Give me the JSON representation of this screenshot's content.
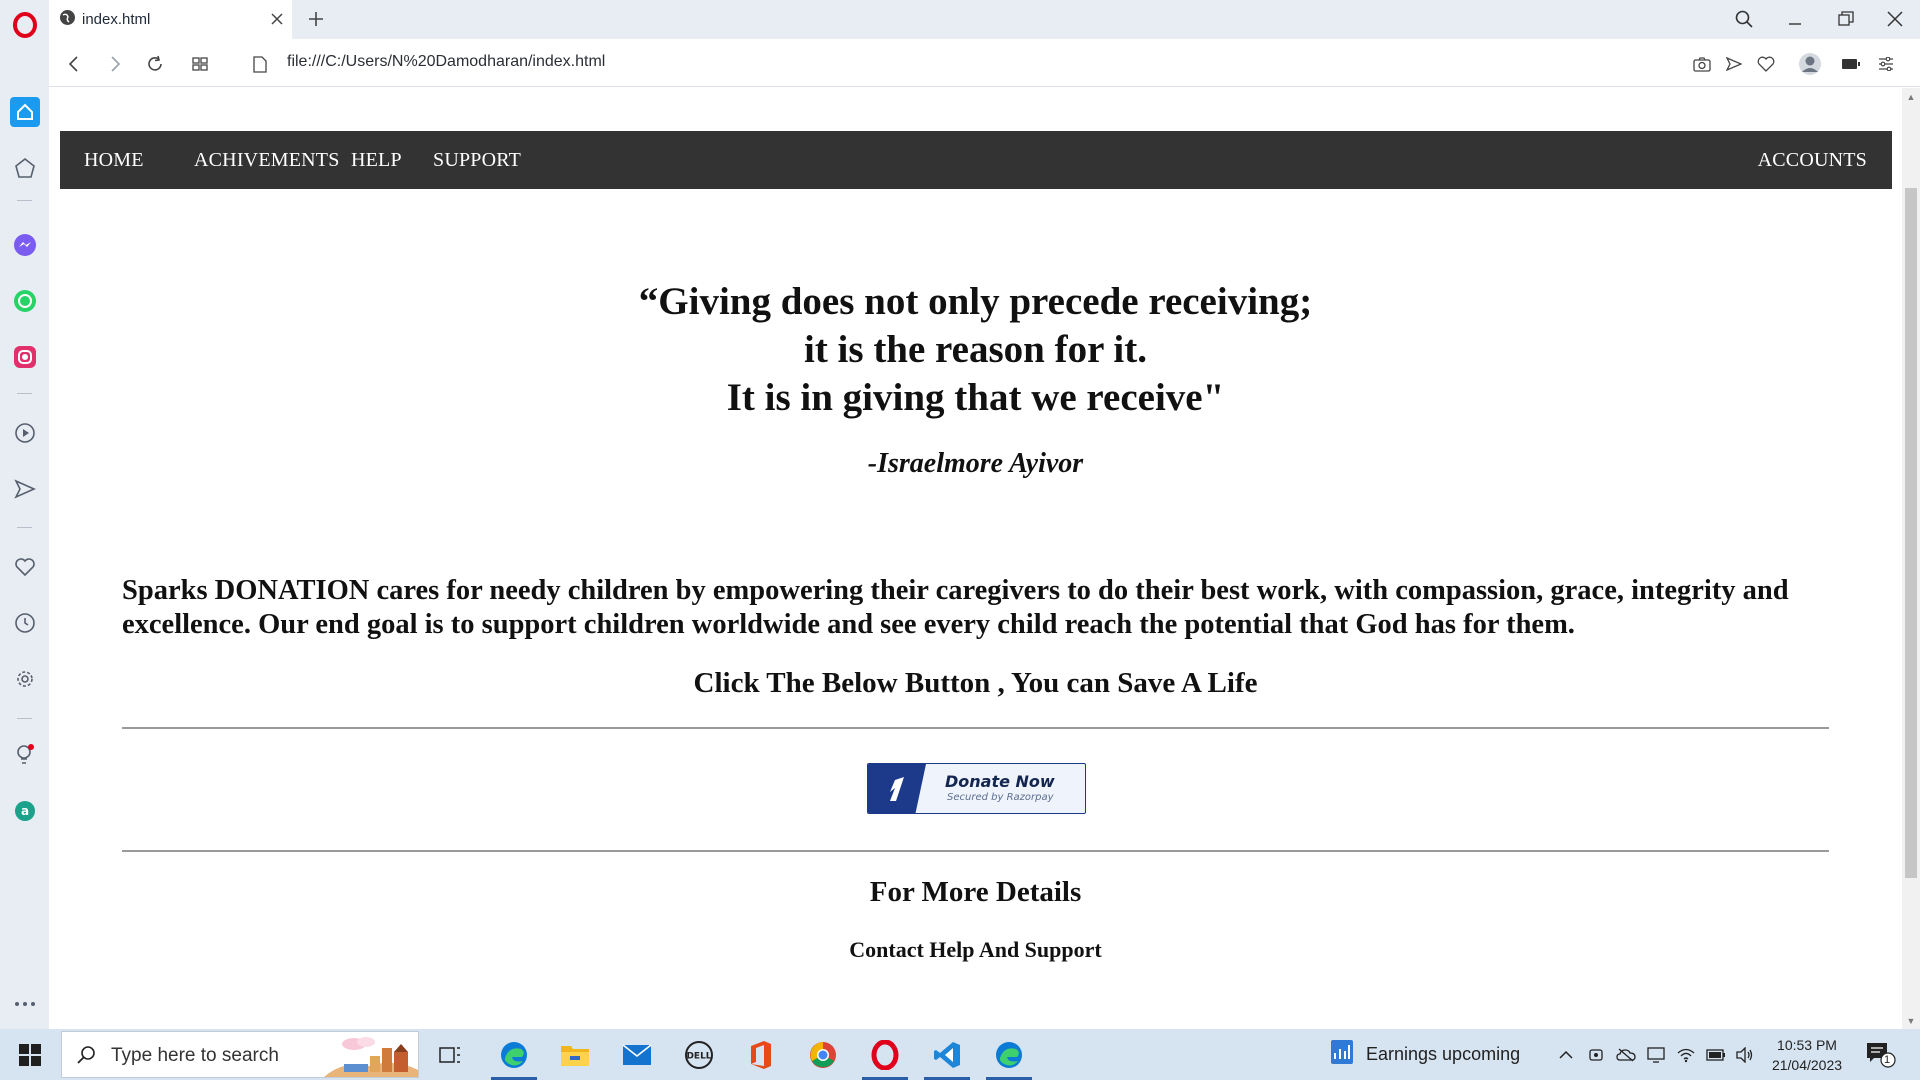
{
  "browser": {
    "tab_title": "index.html",
    "url": "file:///C:/Users/N%20Damodharan/index.html"
  },
  "site": {
    "nav": {
      "items": [
        "HOME",
        "ACHIVEMENTS",
        "HELP",
        "SUPPORT"
      ],
      "right_item": "ACCOUNTS"
    },
    "quote_lines": [
      "“Giving does not only precede receiving;",
      "it is the reason for it.",
      "It is in giving that we receive\""
    ],
    "quote_author": "-Israelmore Ayivor",
    "mission": "Sparks DONATION cares for needy children by empowering their caregivers to do their best work, with compassion, grace, integrity and excellence. Our end goal is to support children worldwide and see every child reach the potential that God has for them.",
    "cta": "Click The Below Button , You can Save A Life",
    "donate_button": {
      "label": "Donate Now",
      "subtitle": "Secured by Razorpay"
    },
    "details_title": "For More Details",
    "details_subtitle": "Contact Help And Support"
  },
  "taskbar": {
    "search_placeholder": "Type here to search",
    "widget_text": "Earnings upcoming",
    "time": "10:53 PM",
    "date": "21/04/2023",
    "notification_count": "1"
  },
  "colors": {
    "nav_background": "#333333",
    "razorpay_blue": "#1d3a8a",
    "opera_red": "#e0001b",
    "sidebar_active": "#1a9bf0"
  }
}
